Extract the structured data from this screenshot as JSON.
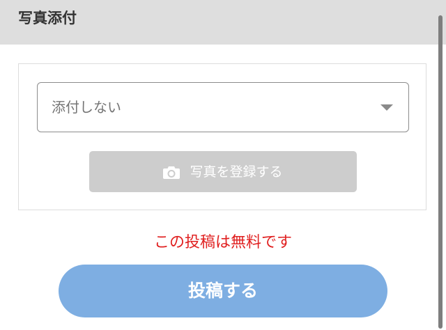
{
  "header": {
    "title": "写真添付"
  },
  "attachment": {
    "select_value": "添付しない",
    "photo_button_label": "写真を登録する"
  },
  "notice": {
    "text": "この投稿は無料です"
  },
  "actions": {
    "post_label": "投稿する"
  },
  "icons": {
    "camera": "camera-icon",
    "dropdown": "chevron-down-icon"
  },
  "colors": {
    "header_bg": "#dedede",
    "notice": "#e02020",
    "post_button": "#7eaee2",
    "photo_button": "#cdcdcd"
  }
}
